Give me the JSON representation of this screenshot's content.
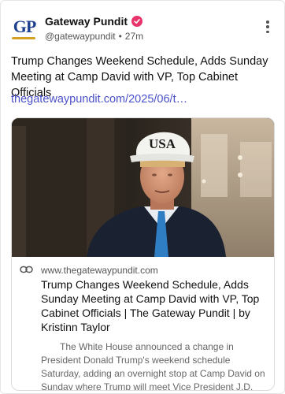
{
  "account": {
    "display_name": "Gateway Pundit",
    "handle": "@gatewaypundit",
    "separator": "•",
    "time_ago": "27m",
    "avatar_text": "GP",
    "verified_color": "#e8336b"
  },
  "post": {
    "text": "Trump Changes Weekend Schedule, Adds Sunday Meeting at Camp David with VP, Top Cabinet Officials",
    "link_text": "thegatewaypundit.com/2025/06/t…"
  },
  "link_preview": {
    "domain": "www.thegatewaypundit.com",
    "title": "Trump Changes Weekend Schedule, Adds Sunday Meeting at Camp David with VP, Top Cabinet Officials | The Gateway Pundit | by Kristinn Taylor",
    "description": "The White House announced a change in President Donald Trump's weekend schedule Saturday, adding an overnight stop at Camp David on Sunday where Trump will meet Vice President J.D.",
    "image_hat_text": "USA"
  },
  "colors": {
    "link": "#4a51c9",
    "brand_blue": "#1f3f8f",
    "brand_gold": "#d6a021"
  }
}
